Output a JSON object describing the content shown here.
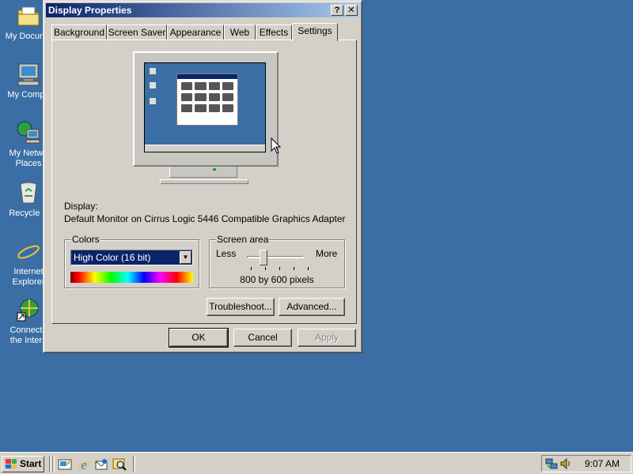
{
  "desktop": {
    "icons": [
      {
        "label": "My Docume",
        "icon": "my-documents-icon"
      },
      {
        "label": "My Compu",
        "icon": "my-computer-icon"
      },
      {
        "label": "My Netwo Places",
        "icon": "my-network-places-icon"
      },
      {
        "label": "Recycle B",
        "icon": "recycle-bin-icon"
      },
      {
        "label": "Internet Explorer",
        "icon": "internet-explorer-icon"
      },
      {
        "label": "Connect t the Intern",
        "icon": "connect-internet-icon"
      }
    ],
    "background_color": "#3a6ea5"
  },
  "dialog": {
    "title": "Display Properties",
    "help_glyph": "?",
    "close_glyph": "✕",
    "tabs": [
      {
        "label": "Background"
      },
      {
        "label": "Screen Saver"
      },
      {
        "label": "Appearance"
      },
      {
        "label": "Web"
      },
      {
        "label": "Effects"
      },
      {
        "label": "Settings",
        "active": true
      }
    ],
    "display_label": "Display:",
    "display_value": "Default Monitor on Cirrus Logic 5446 Compatible Graphics Adapter",
    "colors": {
      "group_label": "Colors",
      "selected": "High Color (16 bit)"
    },
    "screen_area": {
      "group_label": "Screen area",
      "less_label": "Less",
      "more_label": "More",
      "value_text": "800 by 600 pixels",
      "slider_level_fraction": 0.25
    },
    "buttons": {
      "troubleshoot": "Troubleshoot...",
      "advanced": "Advanced...",
      "ok": "OK",
      "cancel": "Cancel",
      "apply": "Apply"
    }
  },
  "taskbar": {
    "start_label": "Start",
    "clock": "9:07 AM",
    "quick_launch": [
      "show-desktop-icon",
      "internet-explorer-icon",
      "outlook-express-icon",
      "search-icon"
    ],
    "tray_icons": [
      "network-icon",
      "volume-icon"
    ]
  }
}
